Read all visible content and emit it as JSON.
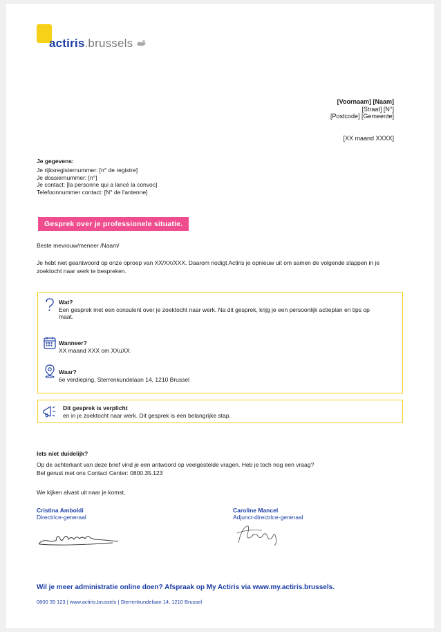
{
  "logo": {
    "brand": "actiris",
    "suffix": ".brussels"
  },
  "recipient": {
    "name": "[Voornaam] [Naam]",
    "street": "[Straat] [N°]",
    "city": "[Postcode] [Gemeente]",
    "date": "[XX maand XXXX]"
  },
  "gegevens": {
    "title": "Je gegevens:",
    "lines": [
      "Je rijksregisternummer: [n° de registre]",
      "Je dossiernummer: [n°]",
      "Je contact: [la personne qui a lancé la convoc]",
      "Telefoonnummer contact: [N° de l'antenne]"
    ]
  },
  "banner": "Gesprek over je professionele situatie.",
  "salutation": "Beste mevrouw/meneer /Naam/",
  "intro": "Je hebt niet geantwoord op onze oproep van XX/XX/XXX. Daarom nodigt Actiris je opnieuw uit om samen de volgende stappen in je zoektocht naar werk te bespreken.",
  "details": {
    "wat_title": "Wat?",
    "wat_text": "Een gesprek met een consulent over je zoektocht naar werk. Na dit gesprek, krijg je een persoonlijk actieplan en tips op maat.",
    "wanneer_title": "Wanneer?",
    "wanneer_text": "XX maand XXX om XXuXX",
    "waar_title": "Waar?",
    "waar_text": "6e verdieping, Sterrenkundelaan 14, 1210 Brussel"
  },
  "notice": {
    "title": "Dit gesprek is verplicht",
    "text": "en in je zoektocht naar werk. Dit gesprek is een belangrijke stap."
  },
  "questions": {
    "title": "Iets niet duidelijk?",
    "text1": "Op de achterkant van deze brief vind je een antwoord op veelgestelde vragen. Heb je toch nog een vraag?",
    "text2": "Bel gerust met ons Contact Center: 0800.35.123"
  },
  "closing": "We kijken alvast uit naar je komst,",
  "signatures": [
    {
      "name": "Cristina Amboldi",
      "role": "Directrice-generaal"
    },
    {
      "name": "Caroline Mancel",
      "role": "Adjunct-directrice-generaal"
    }
  ],
  "footer": {
    "main": "Wil je meer administratie online doen? Afspraak op My Actiris via www.my.actiris.brussels.",
    "sub": "0800 35 123 | www.actiris.brussels | Sterrenkundelaan 14, 1210 Brussel"
  },
  "colors": {
    "brand_blue": "#1b3da4",
    "brand_yellow": "#f7d117",
    "banner_pink": "#ef4d8e"
  },
  "icons": [
    "question-icon",
    "calendar-icon",
    "location-pin-icon",
    "megaphone-icon",
    "heart-hands-icon"
  ]
}
